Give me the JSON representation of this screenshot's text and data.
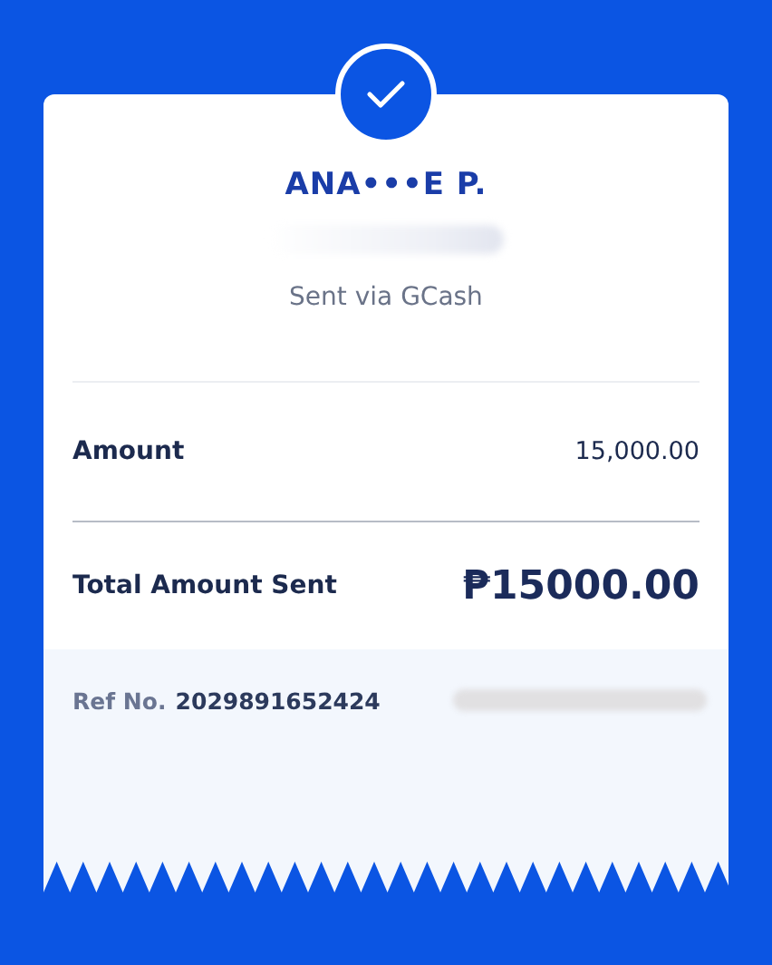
{
  "recipient": {
    "name": "ANA•••E P.",
    "note": "Sent via GCash"
  },
  "amount": {
    "label": "Amount",
    "value": "15,000.00"
  },
  "total": {
    "label": "Total Amount Sent",
    "value": "₱15000.00"
  },
  "reference": {
    "label": "Ref No.",
    "value": "2029891652424"
  }
}
